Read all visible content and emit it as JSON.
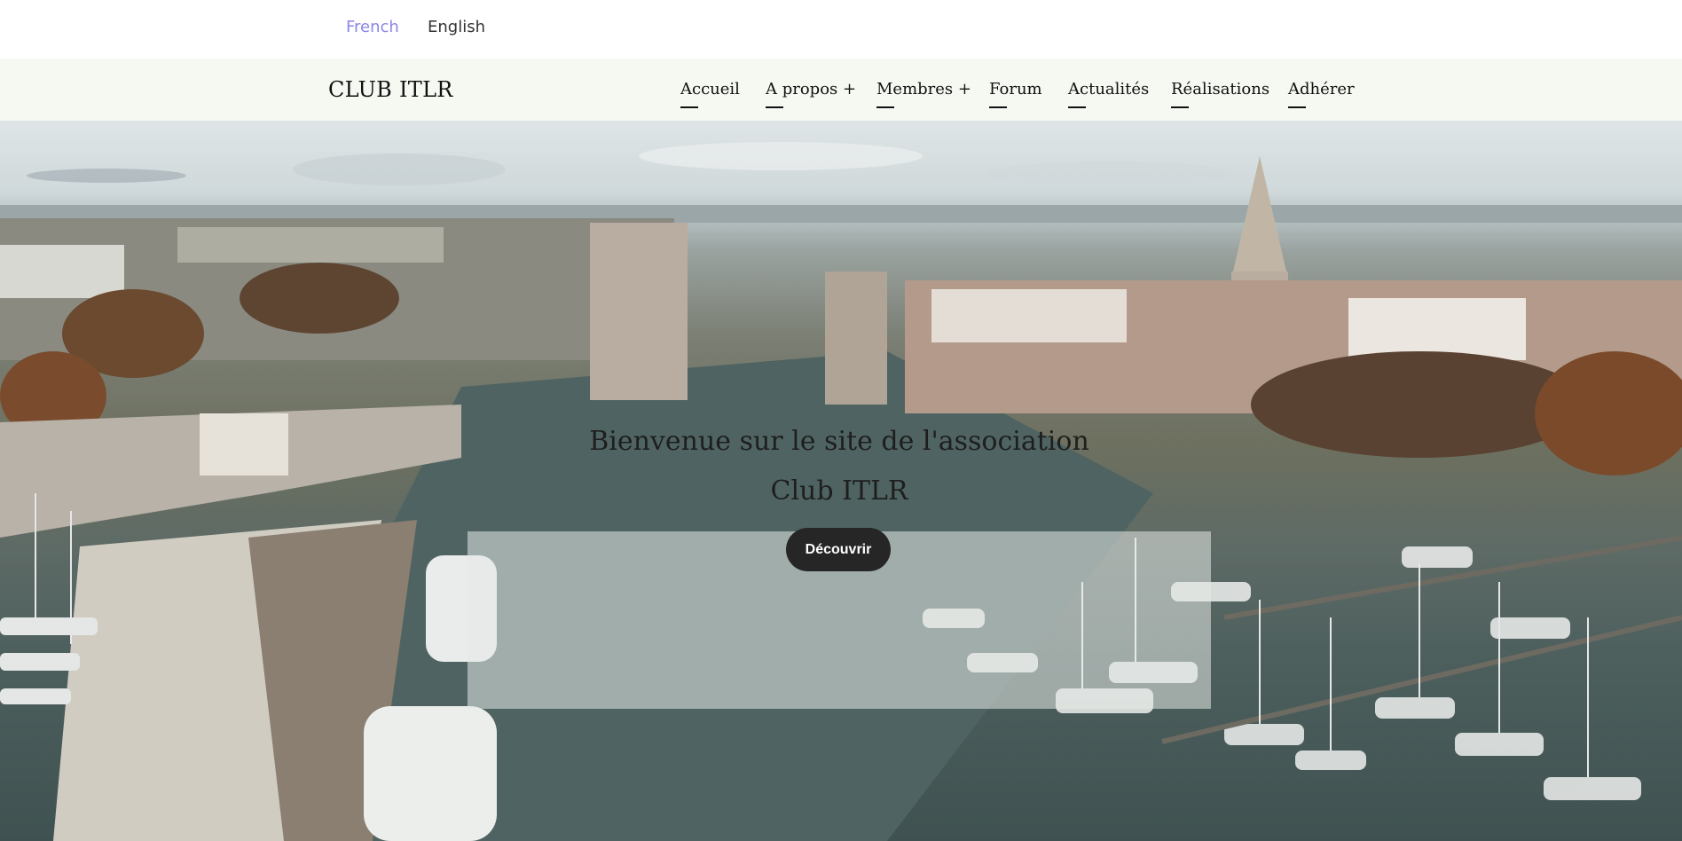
{
  "languages": {
    "french": "French",
    "english": "English"
  },
  "header": {
    "brand": "CLUB ITLR",
    "nav": [
      {
        "label": "Accueil"
      },
      {
        "label": "A propos +"
      },
      {
        "label": "Membres +"
      },
      {
        "label": "Forum"
      },
      {
        "label": "Actualités"
      },
      {
        "label": "Réalisations"
      },
      {
        "label": "Adhérer"
      }
    ]
  },
  "hero": {
    "title_line1": "Bienvenue sur le site de l'association",
    "title_line2": "Club ITLR",
    "cta_label": "Découvrir",
    "image_description_icon": "harbor-photo"
  },
  "colors": {
    "active_language": "#8b86e8",
    "header_bg": "#f5f9f2",
    "cta_bg": "#262626"
  }
}
